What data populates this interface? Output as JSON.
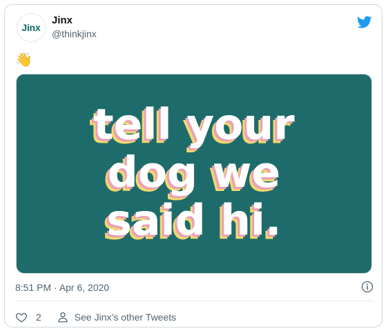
{
  "author": {
    "name": "Jinx",
    "handle": "@thinkjinx",
    "avatar_text": "Jinx"
  },
  "tweet": {
    "emoji": "👋",
    "media_text_lines": [
      "tell your",
      "dog we",
      "said hi."
    ],
    "timestamp": "8:51 PM · Apr 6, 2020"
  },
  "engagement": {
    "like_count": "2",
    "other_tweets_label": "See Jinx’s other Tweets"
  },
  "colors": {
    "media_bg": "#1e6b6b",
    "text_main": "#ffffff",
    "shadow_pink": "#e9a0b8",
    "shadow_yellow": "#f2d96b",
    "twitter_blue": "#1d9bf0"
  }
}
